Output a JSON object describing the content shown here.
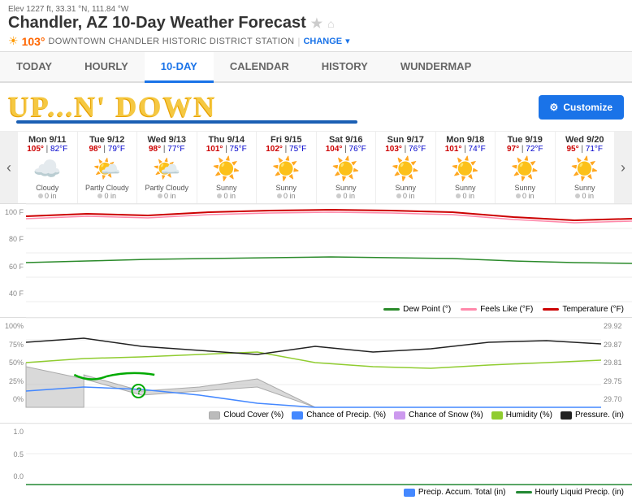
{
  "elevation": "Elev 1227 ft, 33.31 °N, 111.84 °W",
  "title": "Chandler, AZ 10-Day Weather Forecast",
  "temperature": "103°",
  "station": "DOWNTOWN CHANDLER HISTORIC DISTRICT STATION",
  "change_label": "CHANGE",
  "banner": "UP...N' DOWN",
  "customize_label": "Customize",
  "nav": {
    "tabs": [
      "TODAY",
      "HOURLY",
      "10-DAY",
      "CALENDAR",
      "HISTORY",
      "WUNDERMAP"
    ],
    "active": "10-DAY"
  },
  "forecast": [
    {
      "day": "Mon 9/11",
      "high": "105°",
      "low": "82°F",
      "icon": "☁️",
      "desc": "Cloudy",
      "precip": "0 in"
    },
    {
      "day": "Tue 9/12",
      "high": "98°",
      "low": "79°F",
      "icon": "🌤️",
      "desc": "Partly Cloudy",
      "precip": "0 in"
    },
    {
      "day": "Wed 9/13",
      "high": "98°",
      "low": "77°F",
      "icon": "🌤️",
      "desc": "Partly Cloudy",
      "precip": "0 in"
    },
    {
      "day": "Thu 9/14",
      "high": "101°",
      "low": "75°F",
      "icon": "☀️",
      "desc": "Sunny",
      "precip": "0 in"
    },
    {
      "day": "Fri 9/15",
      "high": "102°",
      "low": "75°F",
      "icon": "☀️",
      "desc": "Sunny",
      "precip": "0 in"
    },
    {
      "day": "Sat 9/16",
      "high": "104°",
      "low": "76°F",
      "icon": "☀️",
      "desc": "Sunny",
      "precip": "0 in"
    },
    {
      "day": "Sun 9/17",
      "high": "103°",
      "low": "76°F",
      "icon": "☀️",
      "desc": "Sunny",
      "precip": "0 in"
    },
    {
      "day": "Mon 9/18",
      "high": "101°",
      "low": "74°F",
      "icon": "☀️",
      "desc": "Sunny",
      "precip": "0 in"
    },
    {
      "day": "Tue 9/19",
      "high": "97°",
      "low": "72°F",
      "icon": "☀️",
      "desc": "Sunny",
      "precip": "0 in"
    },
    {
      "day": "Wed 9/20",
      "high": "95°",
      "low": "71°F",
      "icon": "☀️",
      "desc": "Sunny",
      "precip": "0 in"
    }
  ],
  "chart_legend": {
    "dew_point": "Dew Point (°)",
    "feels_like": "Feels Like (°F)",
    "temperature": "Temperature (°F)"
  },
  "precip_legend": {
    "cloud_cover": "Cloud Cover (%)",
    "chance_precip": "Chance of Precip. (%)",
    "chance_snow": "Chance of Snow (%)",
    "humidity": "Humidity (%)",
    "pressure": "Pressure. (in)"
  },
  "accum_legend": {
    "precip_accum": "Precip. Accum. Total (in)",
    "hourly_liquid": "Hourly Liquid Precip. (in)"
  },
  "y_axis_temp": [
    "100 F",
    "80 F",
    "60 F",
    "40 F"
  ],
  "y_axis_precip": [
    "100%",
    "75%",
    "50%",
    "25%",
    "0%"
  ],
  "y_axis_pressure": [
    "29.92",
    "29.87",
    "29.81",
    "29.75",
    "29.70"
  ],
  "y_axis_accum": [
    "1.0",
    "0.5",
    "0.0"
  ]
}
